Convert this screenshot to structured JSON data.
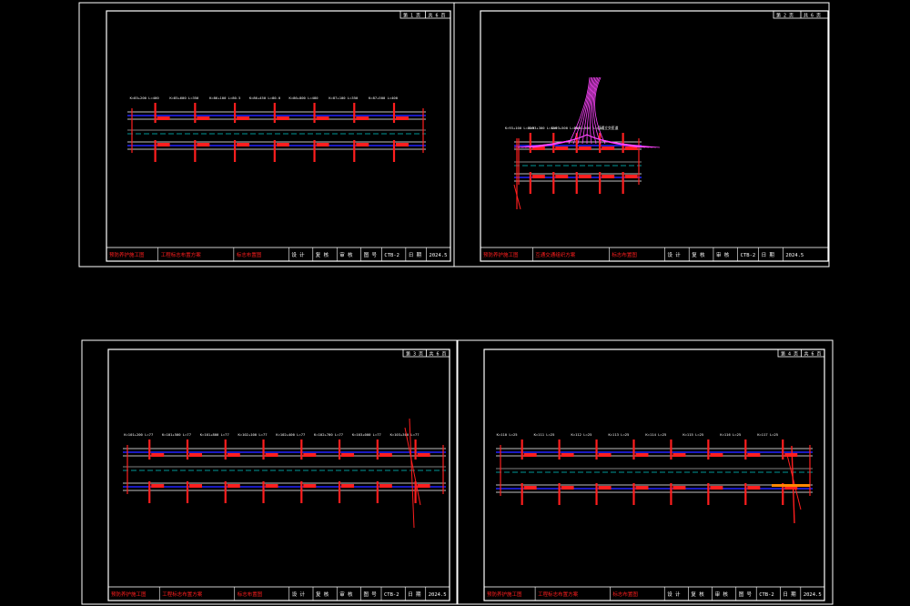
{
  "app": {
    "colors": {
      "background": "#000000",
      "frame": "#ffffff",
      "road_edge": "#2222ff",
      "center_line": "#ffffff",
      "station": "#ff1e1e",
      "ramp": "#ff44ff",
      "dashed": "#00c8c8",
      "yellow": "#e6e600"
    }
  },
  "sheets": [
    {
      "id": "top-left",
      "title_block": {
        "texts": [
          "预防养护施工图",
          "工程标志布置方案",
          "标志布置图",
          "设 计",
          "复 核",
          "审 核",
          "图 号",
          "CTB-2",
          "日 期",
          "2024.5"
        ]
      },
      "sheet_index": [
        "第 1 页",
        "共 6 页"
      ],
      "annotations": [
        "K=85+200 L=400",
        "K=85+600 L=350",
        "K=86+100 L=80.5",
        "K=86+450 L=80.0",
        "K=86+800 L=480",
        "K=87+100 L=350",
        "K=87+500 L=400"
      ]
    },
    {
      "id": "top-right",
      "title_block": {
        "texts": [
          "预防养护施工图",
          "互通交通组织方案",
          "标志布置图",
          "设 计",
          "复 核",
          "审 核",
          "CTB-2",
          "日 期",
          "2024.5"
        ]
      },
      "sheet_index": [
        "第 2 页",
        "共 6 页"
      ],
      "annotations": [
        "K=93+100 L=250",
        "K=93+300 L=150",
        "K=93+500 L=200",
        "K=93+600 L=60",
        "互通立交匝道"
      ]
    },
    {
      "id": "bottom-left",
      "title_block": {
        "texts": [
          "预防养护施工图",
          "工程标志布置方案",
          "标志布置图",
          "设 计",
          "复 核",
          "审 核",
          "图 号",
          "CTB-2",
          "日 期",
          "2024.5"
        ]
      },
      "sheet_index": [
        "第 3 页",
        "共 6 页"
      ],
      "annotations": [
        "K=101+200 L=77",
        "K=101+500 L=77",
        "K=101+800 L=77",
        "K=102+100 L=77",
        "K=102+400 L=77",
        "K=102+700 L=77",
        "K=103+000 L=77",
        "K=103+300 L=77"
      ]
    },
    {
      "id": "bottom-right",
      "title_block": {
        "texts": [
          "预防养护施工图",
          "工程标志布置方案",
          "标志布置图",
          "设 计",
          "复 核",
          "审 核",
          "图 号",
          "CTB-2",
          "日 期",
          "2024.5"
        ]
      },
      "sheet_index": [
        "第 4 页",
        "共 6 页"
      ],
      "annotations": [
        "K=110 L=25",
        "K=111 L=25",
        "K=112 L=25",
        "K=113 L=25",
        "K=114 L=25",
        "K=115 L=25",
        "K=116 L=25",
        "K=117 L=25"
      ]
    }
  ]
}
